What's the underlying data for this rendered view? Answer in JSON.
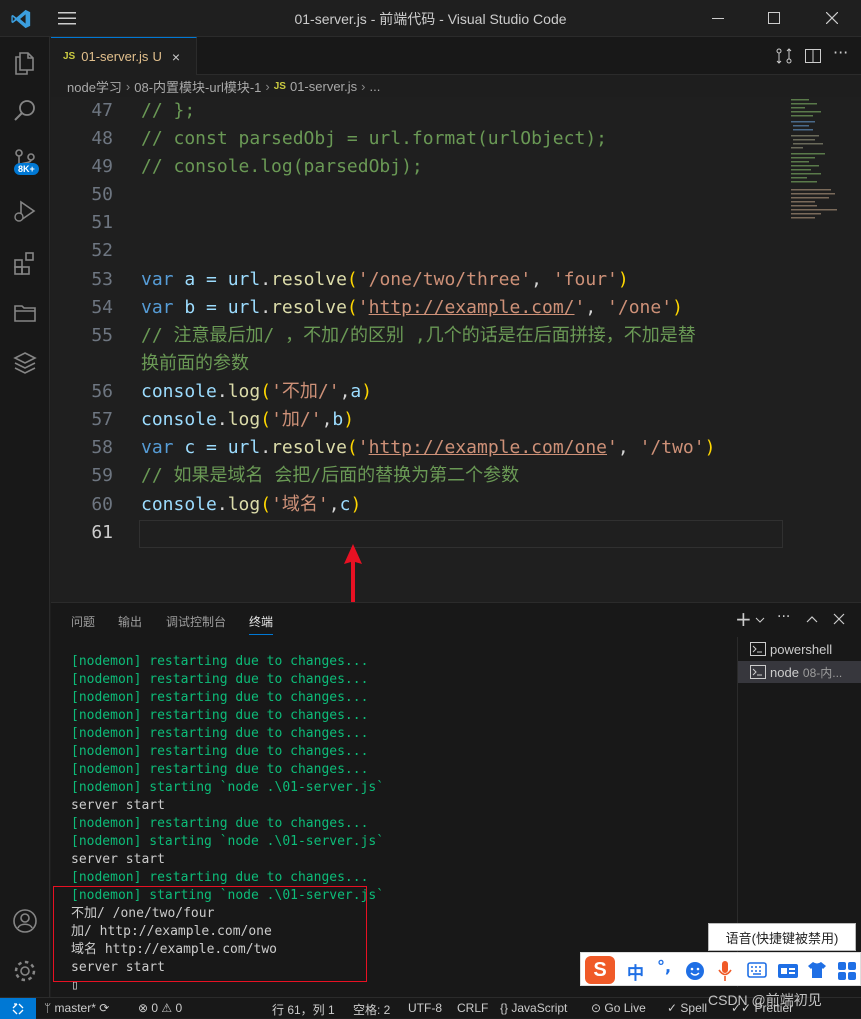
{
  "window": {
    "title": "01-server.js - 前端代码 - Visual Studio Code"
  },
  "activity_bar": {
    "source_control_badge": "8K+"
  },
  "tab": {
    "icon_text": "JS",
    "name": "01-server.js",
    "status": "U",
    "close": "×"
  },
  "breadcrumb": {
    "items": [
      "node学习",
      "08-内置模块-url模块-1",
      "01-server.js",
      "..."
    ],
    "js_icon": "JS"
  },
  "editor": {
    "lines": [
      {
        "n": "47",
        "text": "// };"
      },
      {
        "n": "48",
        "text": "// const parsedObj = url.format(urlObject);"
      },
      {
        "n": "49",
        "text": "// console.log(parsedObj);"
      },
      {
        "n": "50",
        "text": ""
      },
      {
        "n": "51",
        "text": ""
      },
      {
        "n": "52",
        "text": ""
      },
      {
        "n": "53",
        "tokens": [
          "var",
          " a = ",
          "url",
          ".",
          "resolve",
          "(",
          "'/one/two/three'",
          ", ",
          "'four'",
          ")"
        ]
      },
      {
        "n": "54",
        "tokens": [
          "var",
          " b = ",
          "url",
          ".",
          "resolve",
          "(",
          "'",
          "http://example.com/",
          "'",
          ", ",
          "'/one'",
          ")"
        ]
      },
      {
        "n": "55",
        "text": "// 注意最后加/ ，不加/的区别 ,几个的话是在后面拼接，不加是替",
        "cont": "换前面的参数"
      },
      {
        "n": "56",
        "tokens": [
          "console",
          ".",
          "log",
          "(",
          "'不加/'",
          ",",
          "a",
          ")"
        ]
      },
      {
        "n": "57",
        "tokens": [
          "console",
          ".",
          "log",
          "(",
          "'加/'",
          ",",
          "b",
          ")"
        ]
      },
      {
        "n": "58",
        "tokens": [
          "var",
          " c = ",
          "url",
          ".",
          "resolve",
          "(",
          "'",
          "http://example.com/one",
          "'",
          ", ",
          "'/two'",
          ")"
        ]
      },
      {
        "n": "59",
        "text": "// 如果是域名 会把/后面的替换为第二个参数"
      },
      {
        "n": "60",
        "tokens": [
          "console",
          ".",
          "log",
          "(",
          "'域名'",
          ",",
          "c",
          ")"
        ]
      },
      {
        "n": "61",
        "text": ""
      }
    ]
  },
  "panel": {
    "tabs": [
      "问题",
      "输出",
      "调试控制台",
      "终端"
    ],
    "active_tab": "终端",
    "terminal_lines": [
      {
        "t": "[nodemon] restarting due to changes...",
        "c": "green"
      },
      {
        "t": "[nodemon] restarting due to changes...",
        "c": "green"
      },
      {
        "t": "[nodemon] restarting due to changes...",
        "c": "green"
      },
      {
        "t": "[nodemon] restarting due to changes...",
        "c": "green"
      },
      {
        "t": "[nodemon] restarting due to changes...",
        "c": "green"
      },
      {
        "t": "[nodemon] restarting due to changes...",
        "c": "green"
      },
      {
        "t": "[nodemon] restarting due to changes...",
        "c": "green"
      },
      {
        "t": "[nodemon] starting `node .\\01-server.js`",
        "c": "green"
      },
      {
        "t": "server start",
        "c": "white"
      },
      {
        "t": "[nodemon] restarting due to changes...",
        "c": "green"
      },
      {
        "t": "[nodemon] starting `node .\\01-server.js`",
        "c": "green"
      },
      {
        "t": "server start",
        "c": "white"
      },
      {
        "t": "[nodemon] restarting due to changes...",
        "c": "green"
      },
      {
        "t": "[nodemon] starting `node .\\01-server.js`",
        "c": "green"
      },
      {
        "t": "不加/ /one/two/four",
        "c": "white"
      },
      {
        "t": "加/ http://example.com/one",
        "c": "white"
      },
      {
        "t": "域名 http://example.com/two",
        "c": "white"
      },
      {
        "t": "server start",
        "c": "white"
      },
      {
        "t": "▯",
        "c": "white"
      }
    ],
    "terminals": [
      {
        "name": "powershell",
        "sub": ""
      },
      {
        "name": "node",
        "sub": "08-内..."
      }
    ]
  },
  "status_bar": {
    "branch": "master*",
    "errors": "0",
    "warnings": "0",
    "position": "行 61，列 1",
    "spaces": "空格: 2",
    "encoding": "UTF-8",
    "eol": "CRLF",
    "language": "JavaScript",
    "go_live": "Go Live",
    "spell": "Spell",
    "prettier": "Prettier"
  },
  "ime": {
    "tooltip": "语音(快捷键被禁用)",
    "lang": "中",
    "punct": "°,"
  },
  "watermark": "CSDN @前端初见",
  "colors": {
    "accent": "#0078d4",
    "annotation_red": "#e81123",
    "terminal_green": "#0dbc79"
  }
}
